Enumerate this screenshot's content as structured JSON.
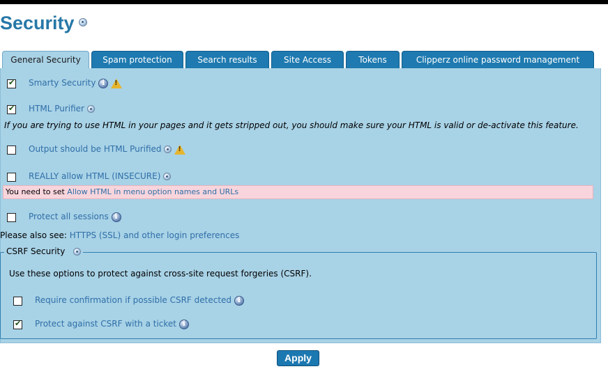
{
  "page": {
    "title": "Security",
    "tabs": [
      "General Security",
      "Spam protection",
      "Search results",
      "Site Access",
      "Tokens",
      "Clipperz online password management"
    ]
  },
  "options": {
    "smarty_security": {
      "label": "Smarty Security",
      "checked": true
    },
    "html_purifier": {
      "label": "HTML Purifier",
      "checked": true,
      "note": "If you are trying to use HTML in your pages and it gets stripped out, you should make sure your HTML is valid or de-activate this feature."
    },
    "output_purified": {
      "label": "Output should be HTML Purified",
      "checked": false
    },
    "allow_html": {
      "label": "REALLY allow HTML (INSECURE)",
      "checked": false
    },
    "allow_html_note_prefix": "You need to set ",
    "allow_html_note_link": "Allow HTML in menu option names and URLs",
    "protect_sessions": {
      "label": "Protect all sessions",
      "checked": false
    }
  },
  "see_also": {
    "prefix": "Please also see: ",
    "link": "HTTPS (SSL) and other login preferences"
  },
  "csrf": {
    "legend": "CSRF Security",
    "description": "Use these options to protect against cross-site request forgeries (CSRF).",
    "require_confirmation": {
      "label": "Require confirmation if possible CSRF detected",
      "checked": false
    },
    "protect_ticket": {
      "label": "Protect against CSRF with a ticket",
      "checked": true
    }
  },
  "apply_label": "Apply",
  "colors": {
    "accent": "#2778a8",
    "panel": "#a8d2e6",
    "tab": "#1e7ab0",
    "link": "#2f6fa8",
    "warning_bg": "#f8d5dc"
  }
}
